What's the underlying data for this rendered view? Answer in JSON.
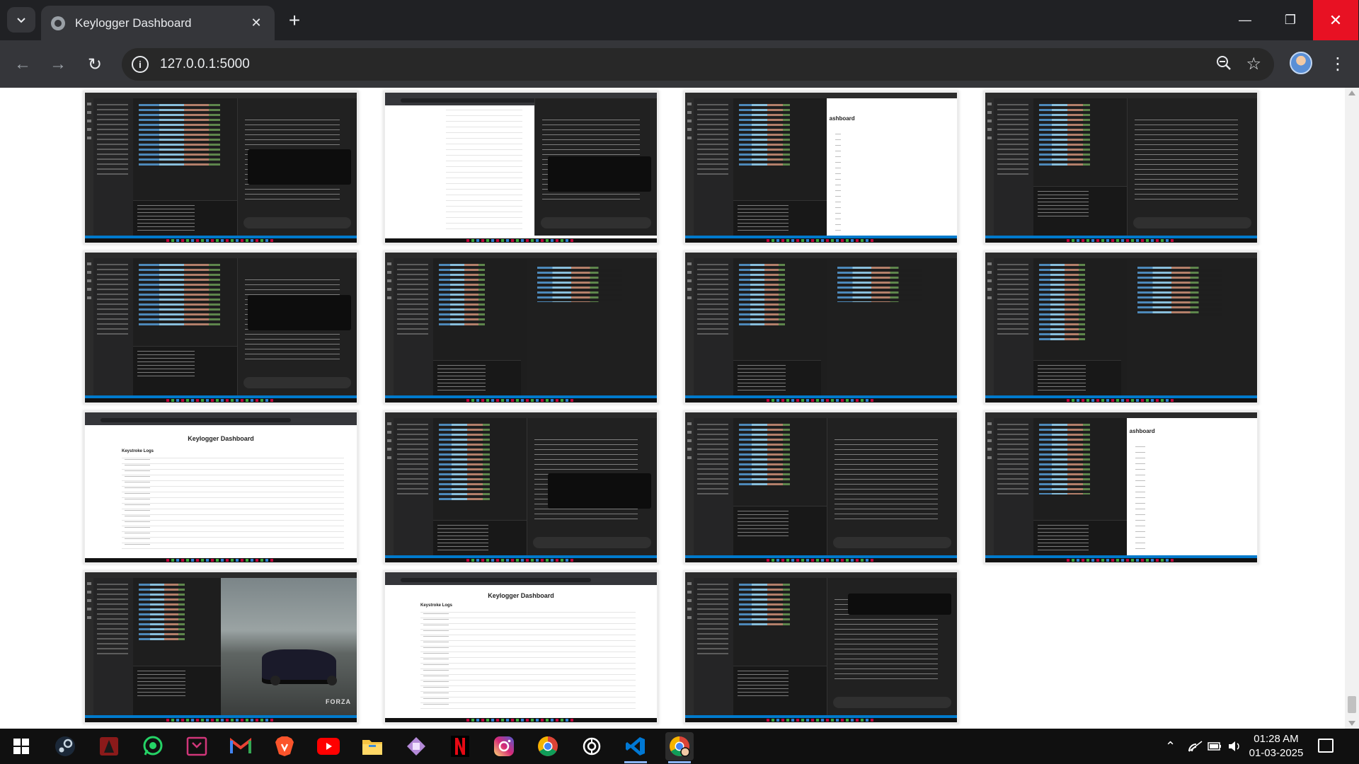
{
  "window": {
    "tab_title": "Keylogger Dashboard",
    "close_tab": "✕",
    "new_tab": "+",
    "minimize": "—",
    "maximize": "❐",
    "close": "✕"
  },
  "toolbar": {
    "url": "127.0.0.1:5000",
    "back": "←",
    "forward": "→",
    "reload": "↻",
    "info": "i",
    "zoom_icon": "⊖",
    "star": "☆",
    "menu": "⋮"
  },
  "thumbnails": [
    {
      "kind": "vscode-chat"
    },
    {
      "kind": "dashboard-chat"
    },
    {
      "kind": "vscode-dashboard",
      "heading": "ashboard"
    },
    {
      "kind": "vscode-chat"
    },
    {
      "kind": "vscode-chat"
    },
    {
      "kind": "vscode-code"
    },
    {
      "kind": "vscode-code"
    },
    {
      "kind": "vscode-code"
    },
    {
      "kind": "dashboard",
      "heading": "Keylogger Dashboard",
      "sub": "Keystroke Logs"
    },
    {
      "kind": "vscode-chat"
    },
    {
      "kind": "vscode-chat"
    },
    {
      "kind": "vscode-dashboard",
      "heading": "ashboard"
    },
    {
      "kind": "vscode-game",
      "game_logo": "FORZA"
    },
    {
      "kind": "dashboard",
      "heading": "Keylogger Dashboard",
      "sub": "Keystroke Logs"
    },
    {
      "kind": "vscode-chat"
    }
  ],
  "taskbar": {
    "apps": [
      "windows-start",
      "steam",
      "game-app",
      "whatsapp",
      "terminal-app",
      "gmail",
      "brave",
      "youtube",
      "file-explorer",
      "gallery-app",
      "netflix",
      "instagram",
      "chrome",
      "chatgpt",
      "vscode",
      "chrome-profile"
    ],
    "chevron": "⌃",
    "time": "01:28 AM",
    "date": "01-03-2025"
  }
}
